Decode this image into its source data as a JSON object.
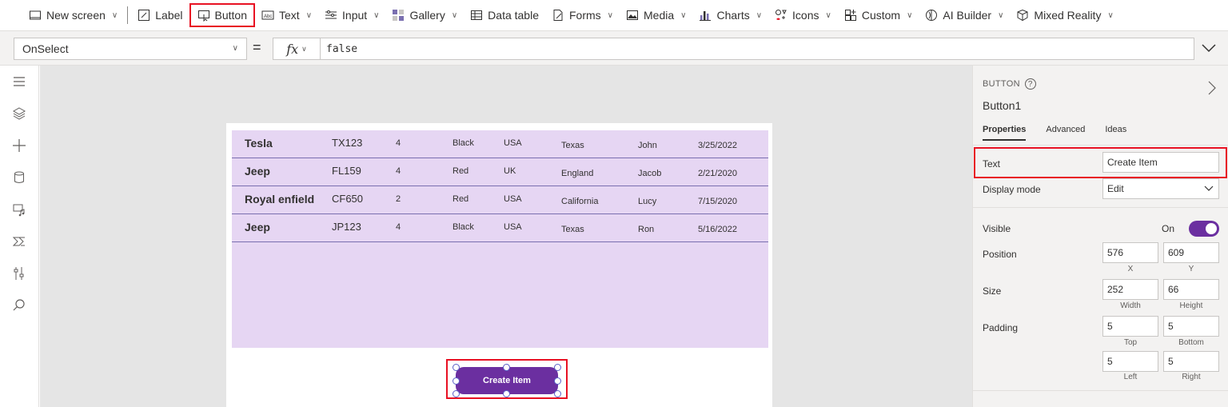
{
  "ribbon": {
    "items": [
      {
        "label": "New screen",
        "icon": "new-screen-icon",
        "dropdown": true
      },
      {
        "label": "Label",
        "icon": "label-icon",
        "dropdown": false
      },
      {
        "label": "Button",
        "icon": "button-icon",
        "dropdown": false
      },
      {
        "label": "Text",
        "icon": "text-icon",
        "dropdown": true
      },
      {
        "label": "Input",
        "icon": "input-icon",
        "dropdown": true
      },
      {
        "label": "Gallery",
        "icon": "gallery-icon",
        "dropdown": true
      },
      {
        "label": "Data table",
        "icon": "data-table-icon",
        "dropdown": false
      },
      {
        "label": "Forms",
        "icon": "forms-icon",
        "dropdown": true
      },
      {
        "label": "Media",
        "icon": "media-icon",
        "dropdown": true
      },
      {
        "label": "Charts",
        "icon": "charts-icon",
        "dropdown": true
      },
      {
        "label": "Icons",
        "icon": "icons-icon",
        "dropdown": true
      },
      {
        "label": "Custom",
        "icon": "custom-icon",
        "dropdown": true
      },
      {
        "label": "AI Builder",
        "icon": "ai-builder-icon",
        "dropdown": true
      },
      {
        "label": "Mixed Reality",
        "icon": "mixed-reality-icon",
        "dropdown": true
      }
    ]
  },
  "formula_bar": {
    "property": "OnSelect",
    "equals": "=",
    "fx": "fx",
    "formula": "false"
  },
  "gallery": {
    "rows": [
      {
        "make": "Tesla",
        "model": "TX123",
        "seats": "4",
        "color": "Black",
        "country": "USA",
        "state": "Texas",
        "owner": "John",
        "date": "3/25/2022"
      },
      {
        "make": "Jeep",
        "model": "FL159",
        "seats": "4",
        "color": "Red",
        "country": "UK",
        "state": "England",
        "owner": "Jacob",
        "date": "2/21/2020"
      },
      {
        "make": "Royal enfield",
        "model": "CF650",
        "seats": "2",
        "color": "Red",
        "country": "USA",
        "state": "California",
        "owner": "Lucy",
        "date": "7/15/2020"
      },
      {
        "make": "Jeep",
        "model": "JP123",
        "seats": "4",
        "color": "Black",
        "country": "USA",
        "state": "Texas",
        "owner": "Ron",
        "date": "5/16/2022"
      }
    ]
  },
  "button": {
    "label": "Create Item",
    "color": "#6b2fa0"
  },
  "pane": {
    "type": "BUTTON",
    "name": "Button1",
    "tabs": [
      "Properties",
      "Advanced",
      "Ideas"
    ],
    "text_label": "Text",
    "text_value": "Create Item",
    "display_mode_label": "Display mode",
    "display_mode_value": "Edit",
    "visible_label": "Visible",
    "visible_value": "On",
    "position_label": "Position",
    "position_x": "576",
    "position_y": "609",
    "x_caption": "X",
    "y_caption": "Y",
    "size_label": "Size",
    "size_width": "252",
    "size_height": "66",
    "width_caption": "Width",
    "height_caption": "Height",
    "padding_label": "Padding",
    "padding_top": "5",
    "padding_bottom": "5",
    "padding_left": "5",
    "padding_right": "5",
    "top_caption": "Top",
    "bottom_caption": "Bottom",
    "left_caption": "Left",
    "right_caption": "Right"
  },
  "colors": {
    "accent": "#6b2fa0",
    "highlight": "#e81123",
    "gallery_bg": "#e6d6f3"
  }
}
